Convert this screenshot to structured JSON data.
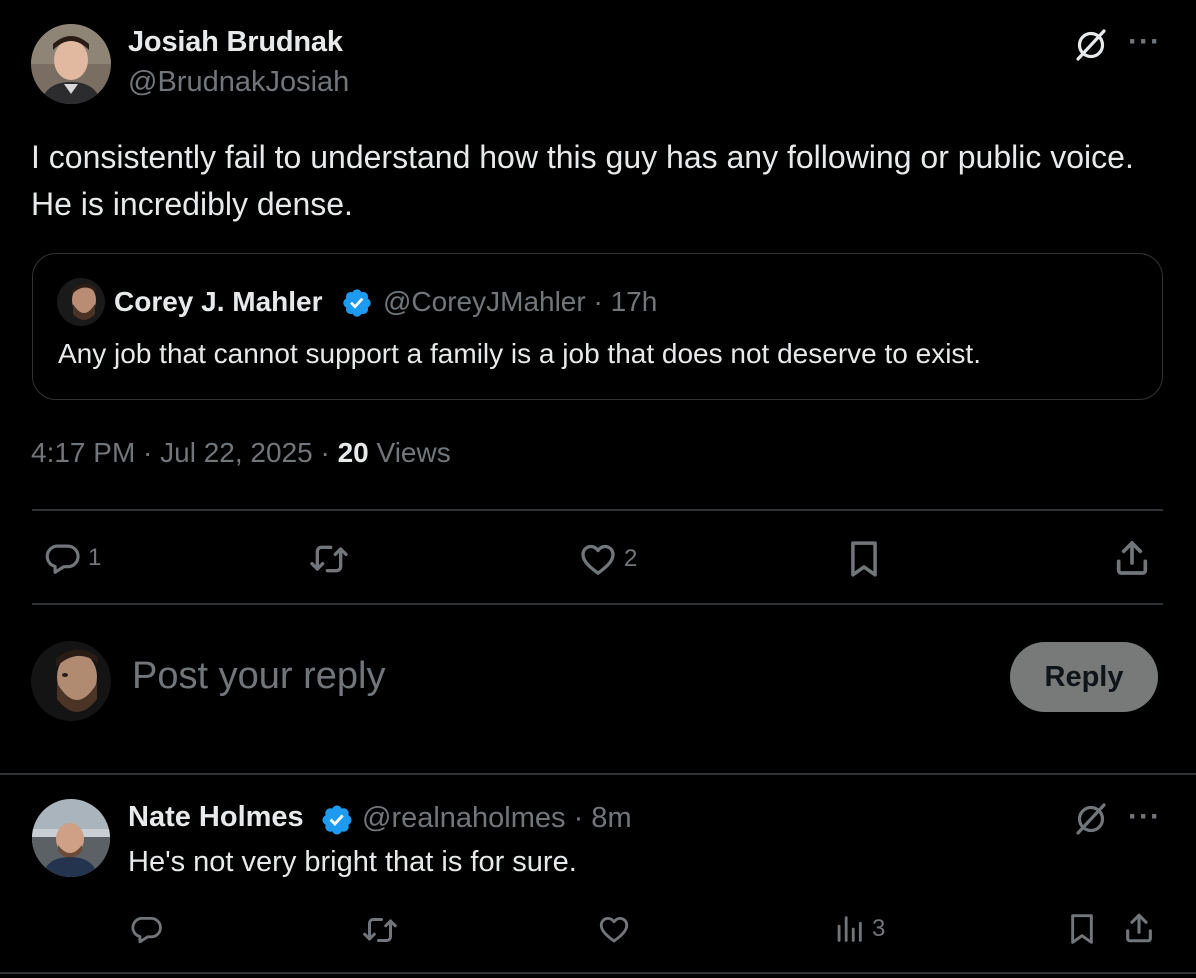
{
  "main_post": {
    "author_name": "Josiah Brudnak",
    "author_handle": "@BrudnakJosiah",
    "text": "I consistently fail to understand how this guy has any following or public voice. He is incredibly dense.",
    "more_label": "···",
    "quote": {
      "author_name": "Corey J. Mahler",
      "verified": true,
      "meta": "@CoreyJMahler · 17h",
      "text": "Any job that cannot support a family is a job that does not deserve to exist."
    },
    "timestamp": "4:17 PM · Jul 22, 2025 · ",
    "views_count": "20",
    "views_label": " Views",
    "actions": {
      "replies": "1",
      "reposts": "",
      "likes": "2"
    }
  },
  "composer": {
    "placeholder": "Post your reply",
    "reply_button": "Reply"
  },
  "reply_post": {
    "author_name": "Nate Holmes",
    "verified": true,
    "meta": "@realnaholmes · 8m",
    "text": "He's not very bright that is for sure.",
    "more_label": "···",
    "actions": {
      "views": "3"
    }
  },
  "colors": {
    "background": "#000000",
    "text_primary": "#e7e9ea",
    "text_secondary": "#71767b",
    "divider": "#2f3336",
    "verified_blue": "#1d9bf0",
    "reply_button_bg": "#787a7a"
  },
  "icons": [
    "grok-icon",
    "more-icon",
    "verified-badge-icon",
    "reply-icon",
    "repost-icon",
    "like-icon",
    "bookmark-icon",
    "share-icon",
    "views-icon"
  ]
}
